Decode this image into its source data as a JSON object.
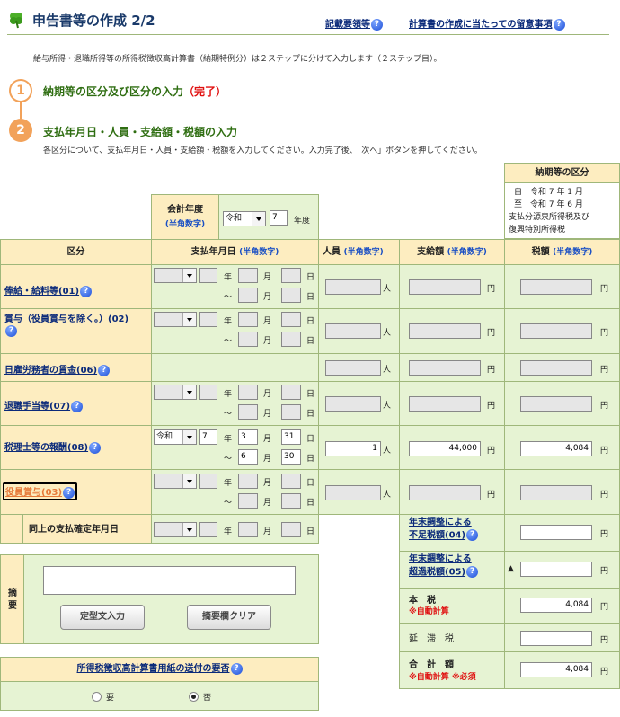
{
  "header": {
    "title": "申告書等の作成",
    "step": "2/2",
    "link1": "記載要領等",
    "link2": "計算書の作成に当たっての留意事項"
  },
  "intro": "給与所得・退職所得等の所得税徴収高計算書（納期特例分）は２ステップに分けて入力します（２ステップ目）。",
  "steps": [
    {
      "num": "1",
      "label": "納期等の区分及び区分の入力",
      "status": "（完了）"
    },
    {
      "num": "2",
      "label": "支払年月日・人員・支給額・税額の入力"
    }
  ],
  "step2_desc": "各区分について、支払年月日・人員・支給額・税額を入力してください。入力完了後、「次へ」ボタンを押してください。",
  "nouki": {
    "title": "納期等の区分",
    "line1": "自　令和 7 年 1 月",
    "line2": "至　令和 7 年 6 月",
    "note1": "支払分源泉所得税及び",
    "note2": "復興特別所得税"
  },
  "fiscal": {
    "label": "会計年度",
    "hint": "(半角数字)",
    "era": "令和",
    "year": "7",
    "unit": "年度"
  },
  "cols": {
    "kubun": "区分",
    "date": "支払年月日",
    "date_hint": "(半角数字)",
    "jinin": "人員",
    "jinin_hint": "(半角数字)",
    "kyuyo": "支給額",
    "kyuyo_hint": "(半角数字)",
    "zeigaku": "税額",
    "zeigaku_hint": "(半角数字)"
  },
  "units": {
    "year": "年",
    "month": "月",
    "day": "日",
    "tilde": "～",
    "person": "人",
    "yen": "円"
  },
  "rows": [
    {
      "label": "俸給・給料等(01)"
    },
    {
      "label": "賞与（役員賞与を除く。）(02)"
    },
    {
      "label": "日雇労務者の賃金(06)"
    },
    {
      "label": "退職手当等(07)"
    },
    {
      "label": "税理士等の報酬(08)",
      "era": "令和",
      "y": "7",
      "m1": "3",
      "d1": "31",
      "m2": "6",
      "d2": "30",
      "persons": "1",
      "amount": "44,000",
      "tax": "4,084"
    },
    {
      "label": "役員賞与(03)"
    }
  ],
  "kakutei": "同上の支払確定年月日",
  "nenmatsu_fusoku": {
    "l1": "年末調整による",
    "l2": "不足税額(04)"
  },
  "nenmatsu_chouka": {
    "l1": "年末調整による",
    "l2": "超過税額(05)",
    "mark": "▲"
  },
  "honzei": {
    "label": "本　税",
    "auto": "※自動計算",
    "value": "4,084"
  },
  "entai": {
    "label": "延　滞　税"
  },
  "gokei": {
    "label": "合　計　額",
    "auto": "※自動計算",
    "req": "※必須",
    "value": "4,084"
  },
  "tekiyo": {
    "label1": "摘",
    "label2": "要",
    "btn1": "定型文入力",
    "btn2": "摘要欄クリア"
  },
  "sofu": {
    "title": "所得税徴収高計算書用紙の送付の要否",
    "opt1": "要",
    "opt2": "否"
  },
  "colors": {
    "accent_orange": "#f2a25a",
    "title_green": "#2f6e12",
    "border": "#9fb77a"
  }
}
